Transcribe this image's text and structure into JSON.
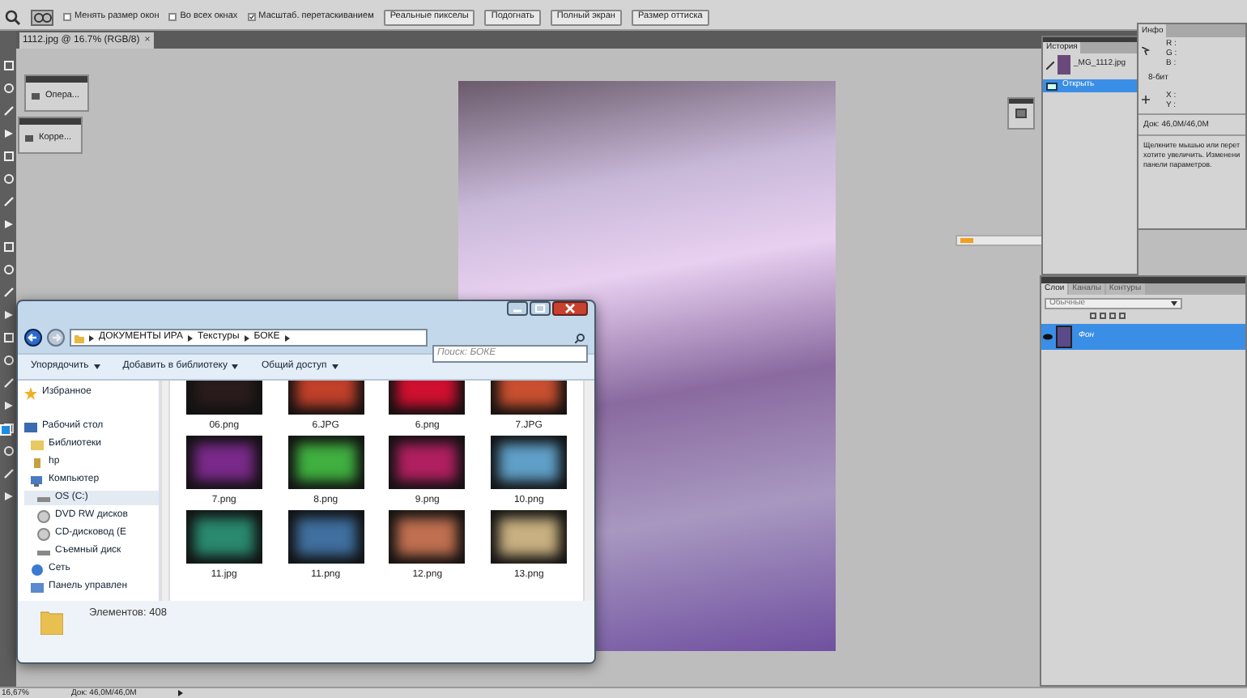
{
  "options_bar": {
    "checkboxes": [
      {
        "label": "Менять размер окон",
        "checked": false
      },
      {
        "label": "Во всех окнах",
        "checked": false
      },
      {
        "label": "Масштаб. перетаскиванием",
        "checked": true
      }
    ],
    "buttons": [
      "Реальные пикселы",
      "Подогнать",
      "Полный экран",
      "Размер оттиска"
    ]
  },
  "document_tab": {
    "title": "1112.jpg @ 16.7% (RGB/8)",
    "close": "×"
  },
  "mini_panels": [
    {
      "label": "Опера..."
    },
    {
      "label": "Корре..."
    }
  ],
  "history_panel": {
    "tab": "История",
    "snapshot": "_MG_1112.jpg",
    "items": [
      {
        "label": "Открыть",
        "selected": true
      }
    ]
  },
  "info_panel": {
    "tab": "Инфо",
    "rgb_labels": [
      "R :",
      "G :",
      "B :"
    ],
    "bit_depth": "8-бит",
    "xy_labels": [
      "X :",
      "Y :"
    ],
    "doc_size": "Док: 46,0M/46,0M",
    "hint_lines": [
      "Щелкните мышью или перет",
      "хотите увеличить. Изменени",
      "панели параметров."
    ]
  },
  "layers_panel": {
    "tabs": [
      {
        "label": "Слои",
        "selected": true
      },
      {
        "label": "Каналы",
        "selected": false
      },
      {
        "label": "Контуры",
        "selected": false
      }
    ],
    "blend_mode": "Обычные",
    "layers": [
      {
        "name": "Фон",
        "selected": true
      }
    ]
  },
  "explorer": {
    "breadcrumb": [
      "ДОКУМЕНТЫ ИРА",
      "Текстуры",
      "БОКЕ"
    ],
    "search_placeholder": "Поиск: БОКЕ",
    "toolbar": [
      "Упорядочить",
      "Добавить в библиотеку",
      "Общий доступ"
    ],
    "sidebar": [
      {
        "label": "Избранное",
        "kind": "star",
        "selected": false
      },
      {
        "label": "Рабочий стол",
        "kind": "desktop",
        "selected": false
      },
      {
        "label": "Библиотеки",
        "kind": "library",
        "selected": false
      },
      {
        "label": "hp",
        "kind": "user",
        "selected": false
      },
      {
        "label": "Компьютер",
        "kind": "computer",
        "selected": false
      },
      {
        "label": "OS (C:)",
        "kind": "drive",
        "selected": true
      },
      {
        "label": "DVD RW дисков",
        "kind": "disc",
        "selected": false
      },
      {
        "label": "CD-дисковод (E",
        "kind": "disc",
        "selected": false
      },
      {
        "label": "Съемный диск",
        "kind": "drive",
        "selected": false
      },
      {
        "label": "Сеть",
        "kind": "network",
        "selected": false
      },
      {
        "label": "Панель управлен",
        "kind": "panel",
        "selected": false
      }
    ],
    "files": [
      {
        "name": "06.png",
        "color": "#2a1c1c"
      },
      {
        "name": "6.JPG",
        "color": "#c0402a"
      },
      {
        "name": "6.png",
        "color": "#d01030"
      },
      {
        "name": "7.JPG",
        "color": "#c85030"
      },
      {
        "name": "7.png",
        "color": "#7a2a8a"
      },
      {
        "name": "8.png",
        "color": "#40b040"
      },
      {
        "name": "9.png",
        "color": "#b02060"
      },
      {
        "name": "10.png",
        "color": "#60a0c8"
      },
      {
        "name": "11.jpg",
        "color": "#2a8a70"
      },
      {
        "name": "11.png",
        "color": "#4070a0"
      },
      {
        "name": "12.png",
        "color": "#c07050"
      },
      {
        "name": "13.png",
        "color": "#c8b080"
      }
    ],
    "item_count": "Элементов: 408"
  },
  "status_bar": {
    "zoom": "16,67%",
    "doc": "Док: 46,0M/46,0M"
  }
}
